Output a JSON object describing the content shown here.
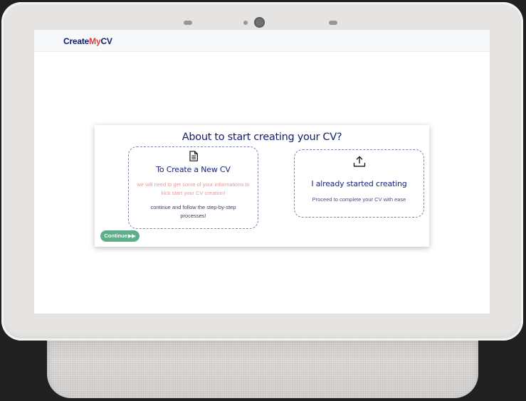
{
  "app": {
    "brand": {
      "part_a": "Create",
      "part_b": "My",
      "part_c": "CV"
    }
  },
  "modal": {
    "title": "About to start creating your CV?",
    "options": [
      {
        "icon": "document-icon",
        "title": "To Create a New CV",
        "hint": "we will need to get some of your informations to kick start your CV creation!",
        "description": "continue and follow the step-by-step processes!"
      },
      {
        "icon": "upload-icon",
        "title": "I already started creating",
        "description": "Proceed to complete your CV with ease"
      }
    ],
    "continue_label": "Continue",
    "continue_icon": "fast-forward-icon"
  },
  "colors": {
    "brand_navy": "#101c6e",
    "brand_red": "#e23b3b",
    "continue_green": "#5fae8a",
    "hint_pink": "#e89a96"
  }
}
